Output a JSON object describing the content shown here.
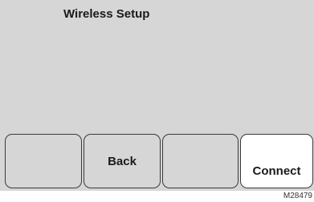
{
  "screen": {
    "title": "Wireless Setup"
  },
  "softkeys": [
    {
      "label": ""
    },
    {
      "label": "Back"
    },
    {
      "label": ""
    },
    {
      "label": "Connect"
    }
  ],
  "figure_id": "M28479",
  "colors": {
    "screen_background": "#d6d6d6",
    "highlighted_key": "#ffffff",
    "key_border": "#3a3a3a",
    "text": "#1a1a1a"
  }
}
